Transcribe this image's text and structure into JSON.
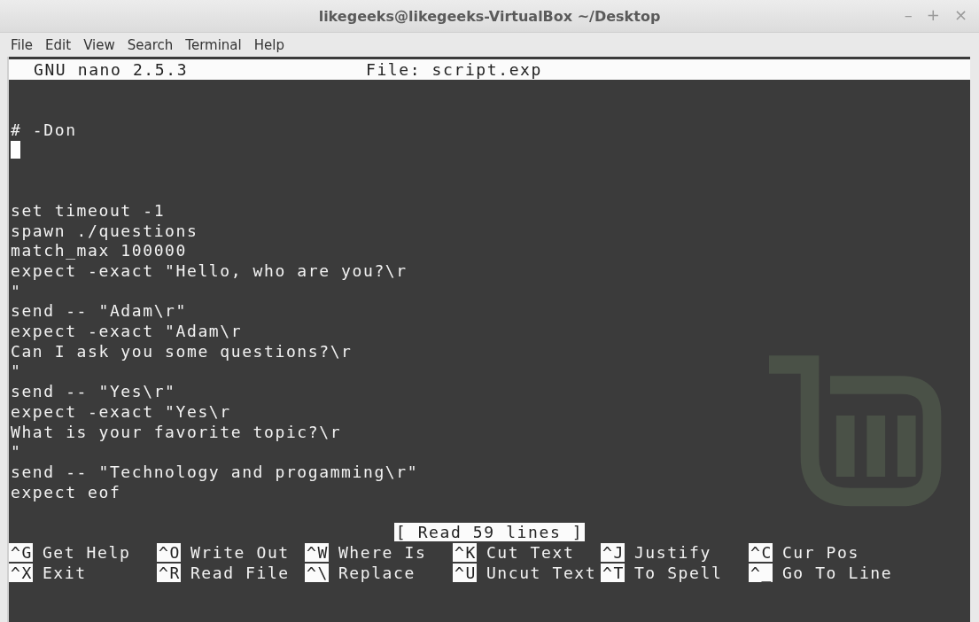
{
  "window": {
    "title": "likegeeks@likegeeks-VirtualBox ~/Desktop",
    "controls": [
      "–",
      "+",
      "×"
    ]
  },
  "menu": [
    "File",
    "Edit",
    "View",
    "Search",
    "Terminal",
    "Help"
  ],
  "nano": {
    "version": "GNU nano 2.5.3",
    "file": "File: script.exp"
  },
  "lines": [
    {
      "kind": "blank"
    },
    {
      "kind": "blank"
    },
    {
      "kind": "text",
      "text": "# -Don"
    },
    {
      "kind": "cursor"
    },
    {
      "kind": "blank"
    },
    {
      "kind": "blank"
    },
    {
      "kind": "text",
      "text": "set timeout -1"
    },
    {
      "kind": "text",
      "text": "spawn ./questions"
    },
    {
      "kind": "text",
      "text": "match_max 100000"
    },
    {
      "kind": "text",
      "text": "expect -exact \"Hello, who are you?\\r"
    },
    {
      "kind": "text",
      "text": "\""
    },
    {
      "kind": "text",
      "text": "send -- \"Adam\\r\""
    },
    {
      "kind": "text",
      "text": "expect -exact \"Adam\\r"
    },
    {
      "kind": "text",
      "text": "Can I ask you some questions?\\r"
    },
    {
      "kind": "text",
      "text": "\""
    },
    {
      "kind": "text",
      "text": "send -- \"Yes\\r\""
    },
    {
      "kind": "text",
      "text": "expect -exact \"Yes\\r"
    },
    {
      "kind": "text",
      "text": "What is your favorite topic?\\r"
    },
    {
      "kind": "text",
      "text": "\""
    },
    {
      "kind": "text",
      "text": "send -- \"Technology and progamming\\r\""
    },
    {
      "kind": "text",
      "text": "expect eof"
    },
    {
      "kind": "blank"
    }
  ],
  "status": "[ Read 59 lines ]",
  "shortcuts": [
    {
      "key": "^G",
      "label": "Get Help"
    },
    {
      "key": "^O",
      "label": "Write Out"
    },
    {
      "key": "^W",
      "label": "Where Is"
    },
    {
      "key": "^K",
      "label": "Cut Text"
    },
    {
      "key": "^J",
      "label": "Justify"
    },
    {
      "key": "^C",
      "label": "Cur Pos"
    },
    {
      "key": "^X",
      "label": "Exit"
    },
    {
      "key": "^R",
      "label": "Read File"
    },
    {
      "key": "^\\",
      "label": "Replace"
    },
    {
      "key": "^U",
      "label": "Uncut Text"
    },
    {
      "key": "^T",
      "label": "To Spell"
    },
    {
      "key": "^_",
      "label": "Go To Line"
    }
  ]
}
